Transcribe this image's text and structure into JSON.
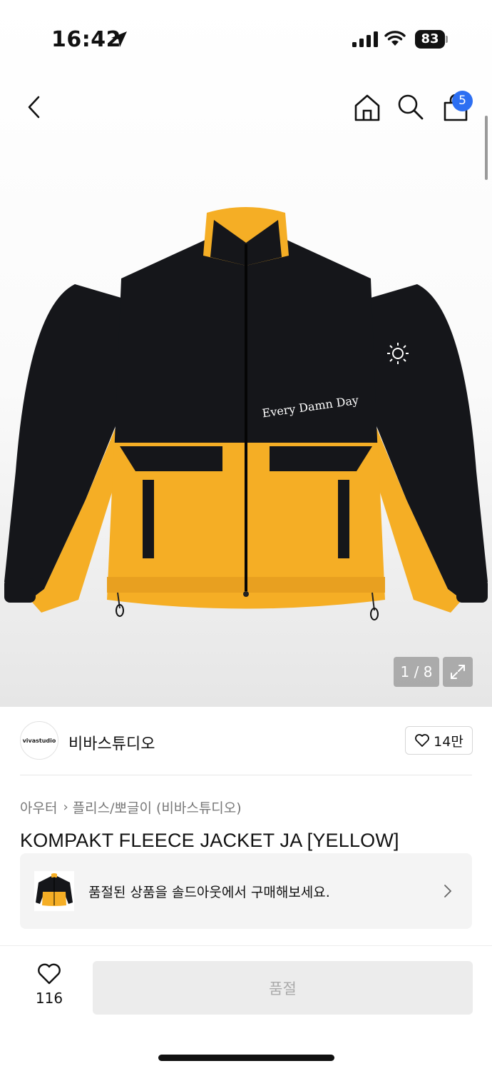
{
  "status_bar": {
    "time": "16:42",
    "battery_level": "83",
    "icons": [
      "location-arrow-icon",
      "signal-icon",
      "wifi-icon",
      "battery-icon"
    ]
  },
  "header": {
    "icons": [
      "back-icon",
      "home-icon",
      "search-icon",
      "cart-icon"
    ],
    "cart_count": "5"
  },
  "gallery": {
    "counter": "1 / 8",
    "current_image": 1,
    "total_images": 8,
    "expand_icon": "expand-icon",
    "image_text": "Every Damn Day"
  },
  "brand": {
    "logo_text": "vivastudio",
    "name": "비바스튜디오",
    "like_count": "14만"
  },
  "breadcrumb": {
    "category": "아우터",
    "subcategory": "플리스/뽀글이 (비바스튜디오)"
  },
  "product": {
    "title": "KOMPAKT FLEECE JACKET JA [YELLOW]"
  },
  "soldout_banner": {
    "text": "품절된 상품을 솔드아웃에서 구매해보세요."
  },
  "bottom_bar": {
    "like_count": "116",
    "buy_label": "품절"
  },
  "colors": {
    "accent_badge": "#2d6ff2",
    "jacket_yellow": "#f5ae25",
    "jacket_black": "#15161a",
    "disabled_button": "#ececec"
  }
}
